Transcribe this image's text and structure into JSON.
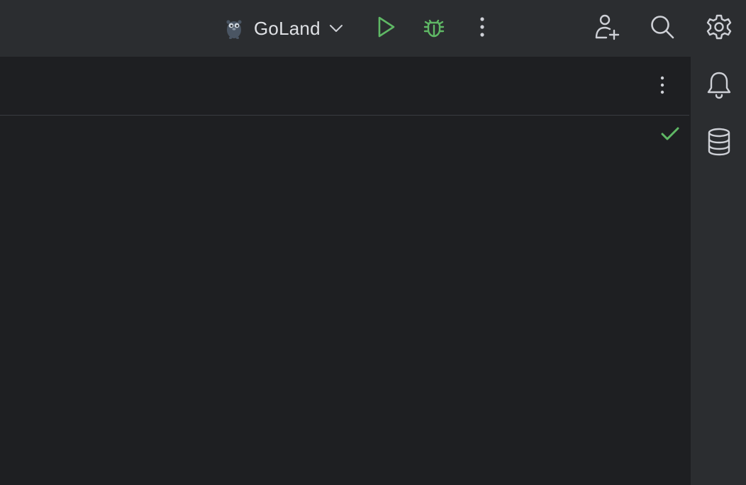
{
  "toolbar": {
    "run_configuration": {
      "label": "GoLand",
      "icon": "gopher-icon",
      "dropdown_icon": "chevron-down-icon"
    },
    "run_button": {
      "icon": "play-icon",
      "color": "#5fb865"
    },
    "debug_button": {
      "icon": "bug-icon",
      "color": "#5fb865"
    },
    "more_button": {
      "icon": "vertical-ellipsis-icon"
    },
    "add_user_button": {
      "icon": "person-add-icon"
    },
    "search_button": {
      "icon": "search-icon"
    },
    "settings_button": {
      "icon": "gear-icon"
    }
  },
  "editor": {
    "header_more_button": {
      "icon": "vertical-ellipsis-icon"
    },
    "inspection_status": {
      "icon": "checkmark-icon",
      "color": "#5fb865"
    }
  },
  "right_tool_strip": {
    "items": [
      {
        "icon": "bell-icon"
      },
      {
        "icon": "database-icon"
      }
    ]
  },
  "colors": {
    "background": "#1e1f22",
    "toolbar": "#2b2d30",
    "text": "#dfe1e5",
    "icon": "#ced0d6",
    "accent_green": "#5fb865"
  }
}
